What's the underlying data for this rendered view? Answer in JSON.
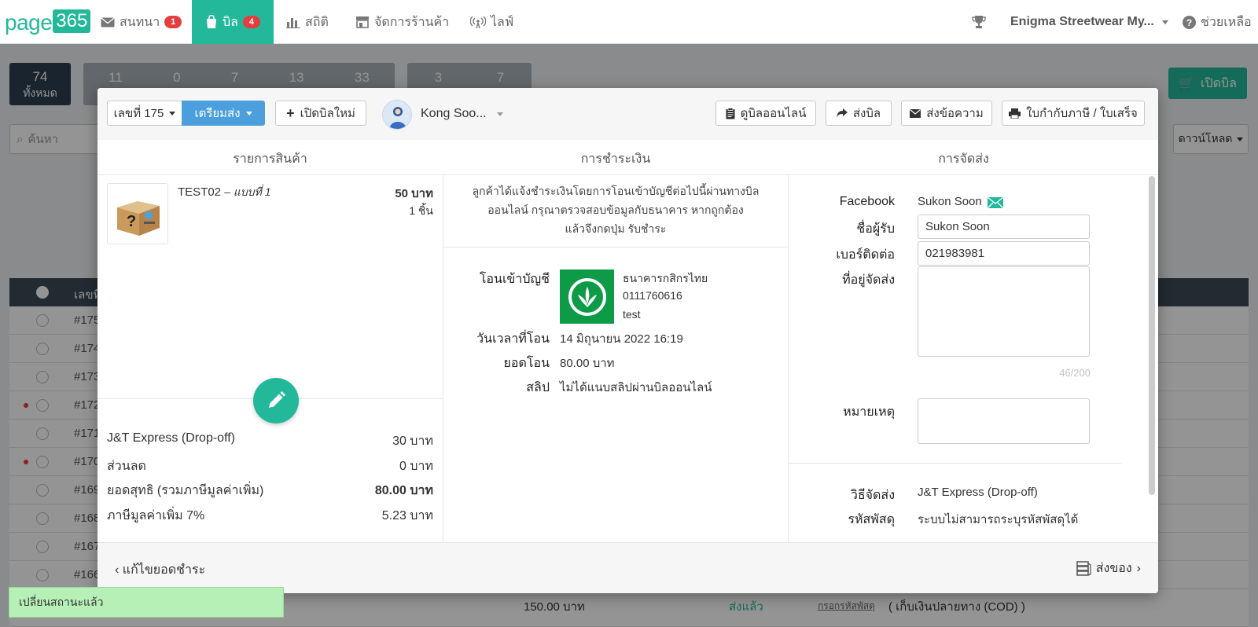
{
  "nav": {
    "logo_text": "page",
    "logo_num": "365",
    "items": [
      {
        "label": "สนทนา",
        "badge": "1",
        "icon": "mail-icon"
      },
      {
        "label": "บิล",
        "badge": "4",
        "icon": "bag-icon",
        "active": true
      },
      {
        "label": "สถิติ",
        "icon": "bar-chart-icon"
      },
      {
        "label": "จัดการร้านค้า",
        "icon": "store-icon"
      },
      {
        "label": "ไลฟ์",
        "icon": "broadcast-icon"
      }
    ],
    "shop_name": "Enigma Streetwear My...",
    "help": "ช่วยเหลือ"
  },
  "background": {
    "total_count": "74",
    "total_label": "ทั้งหมด",
    "counts": [
      "11",
      "0",
      "7",
      "13",
      "33"
    ],
    "counts2": [
      "3",
      "7"
    ],
    "search_placeholder": "ค้นหา",
    "open_bill": "เปิดบิล",
    "download": "ดาวน์โหลด",
    "col_id": "เลขที่",
    "rows": [
      "#175",
      "#174",
      "#173",
      "#172",
      "#171",
      "#170",
      "#169",
      "#168",
      "#167",
      "#166"
    ],
    "bottom_amount": "150.00 บาท",
    "bottom_status": "ส่งแล้ว",
    "bottom_link": "กรอกรหัสพัสดุ",
    "bottom_cod": "( เก็บเงินปลายทาง (COD) )"
  },
  "modal": {
    "bill_no": "เลขที่ 175",
    "status": "เตรียมส่ง",
    "new_bill": "เปิดบิลใหม่",
    "customer": "Kong Soo...",
    "view_online": "ดูบิลออนไลน์",
    "send_bill": "ส่งบิล",
    "send_message": "ส่งข้อความ",
    "tax_invoice": "ใบกำกับภาษี / ใบเสร็จ",
    "col_products": "รายการสินค้า",
    "col_payment": "การชำระเงิน",
    "col_shipping": "การจัดส่ง",
    "product": {
      "name": "TEST02",
      "variant": "– แบบที่ 1",
      "price": "50 บาท",
      "qty": "1 ชิ้น"
    },
    "summary": [
      {
        "label": "J&T Express (Drop-off)",
        "value": "30 บาท",
        "bold": false
      },
      {
        "label": "ส่วนลด",
        "value": "0 บาท",
        "bold": false
      },
      {
        "label": "ยอดสุทธิ (รวมภาษีมูลค่าเพิ่ม)",
        "value": "80.00 บาท",
        "bold": true
      },
      {
        "label": "ภาษีมูลค่าเพิ่ม 7%",
        "value": "5.23 บาท",
        "bold": false
      }
    ],
    "payment": {
      "notice_line1": "ลูกค้าได้แจ้งชำระเงินโดยการโอนเข้าบัญชีต่อไปนี้ผ่านทางบิล",
      "notice_line2": "ออนไลน์ กรุณาตรวจสอบข้อมูลกับธนาคาร หากถูกต้อง",
      "notice_line3": "แล้วจึงกดปุ่ม รับชำระ",
      "account_label": "โอนเข้าบัญชี",
      "bank_name": "ธนาคารกสิกรไทย",
      "account_no": "0111760616",
      "account_name": "test",
      "time_label": "วันเวลาที่โอน",
      "time_value": "14 มิถุนายน 2022 16:19",
      "amount_label": "ยอดโอน",
      "amount_value": "80.00 บาท",
      "slip_label": "สลิป",
      "slip_value": "ไม่ได้แนบสลิปผ่านบิลออนไลน์"
    },
    "shipping": {
      "facebook_label": "Facebook",
      "facebook_value": "Sukon Soon",
      "recipient_label": "ชื่อผู้รับ",
      "recipient_value": "Sukon Soon",
      "phone_label": "เบอร์ติดต่อ",
      "phone_value": "021983981",
      "address_label": "ที่อยู่จัดส่ง",
      "char_count": "46/200",
      "note_label": "หมายเหตุ",
      "method_label": "วิธีจัดส่ง",
      "method_value": "J&T Express (Drop-off)",
      "tracking_label": "รหัสพัสดุ",
      "tracking_value": "ระบบไม่สามารถระบุรหัสพัสดุได้"
    },
    "footer_back": "แก้ไขยอดชำระ",
    "footer_next": "ส่งของ"
  },
  "toast": "เปลี่ยนสถานะแล้ว",
  "colors": {
    "accent": "#24b89a",
    "blue": "#4a9fdc",
    "badge": "#e53e3e",
    "bank": "#0e9b48"
  }
}
